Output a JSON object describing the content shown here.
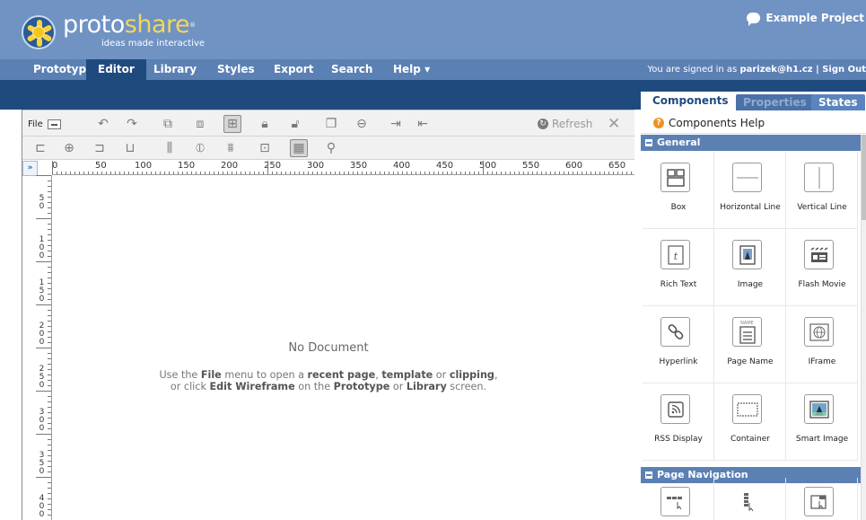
{
  "brand": {
    "logo_part1": "proto",
    "logo_part2": "share",
    "reg": "®",
    "tagline": "ideas made interactive"
  },
  "project": {
    "name": "Example Project"
  },
  "nav": {
    "tabs": [
      "Prototype",
      "Editor",
      "Library",
      "Styles",
      "Export",
      "Search",
      "Help ▾"
    ],
    "active": "Editor",
    "signed_prefix": "You are signed in as ",
    "user": "parizek@h1.cz",
    "sign_out": " | Sign Out"
  },
  "toolbar": {
    "file_label": "File",
    "refresh_label": "Refresh",
    "close_label": "✕"
  },
  "ruler": {
    "h_labels": [
      "0",
      "50",
      "100",
      "150",
      "200",
      "250",
      "300",
      "350",
      "400",
      "450",
      "500",
      "550",
      "600",
      "650"
    ],
    "v_labels": [
      "50",
      "100",
      "150",
      "200",
      "250",
      "300",
      "350",
      "400"
    ]
  },
  "canvas": {
    "no_doc": "No Document",
    "hint_1a": "Use the ",
    "hint_file": "File",
    "hint_1b": " menu to open a ",
    "hint_recent": "recent page",
    "hint_1c": ", ",
    "hint_template": "template",
    "hint_1d": " or ",
    "hint_clipping": "clipping",
    "hint_1e": ",",
    "hint_2a": "or click ",
    "hint_edit": "Edit Wireframe",
    "hint_2b": " on the ",
    "hint_prototype": "Prototype",
    "hint_2c": " or ",
    "hint_library": "Library",
    "hint_2d": " screen."
  },
  "panel": {
    "tabs": [
      "Components",
      "Properties",
      "States"
    ],
    "help": "Components Help",
    "sections": [
      "General",
      "Page Navigation"
    ],
    "components": [
      {
        "label": "Box",
        "icon": "box-icon"
      },
      {
        "label": "Horizontal Line",
        "icon": "horizontal-line-icon"
      },
      {
        "label": "Vertical Line",
        "icon": "vertical-line-icon"
      },
      {
        "label": "Rich Text",
        "icon": "rich-text-icon"
      },
      {
        "label": "Image",
        "icon": "image-icon"
      },
      {
        "label": "Flash Movie",
        "icon": "flash-movie-icon"
      },
      {
        "label": "Hyperlink",
        "icon": "hyperlink-icon"
      },
      {
        "label": "Page Name",
        "icon": "page-name-icon"
      },
      {
        "label": "IFrame",
        "icon": "iframe-icon"
      },
      {
        "label": "RSS Display",
        "icon": "rss-icon"
      },
      {
        "label": "Container",
        "icon": "container-icon"
      },
      {
        "label": "Smart Image",
        "icon": "smart-image-icon"
      }
    ],
    "page_name_tag": "NAME"
  }
}
